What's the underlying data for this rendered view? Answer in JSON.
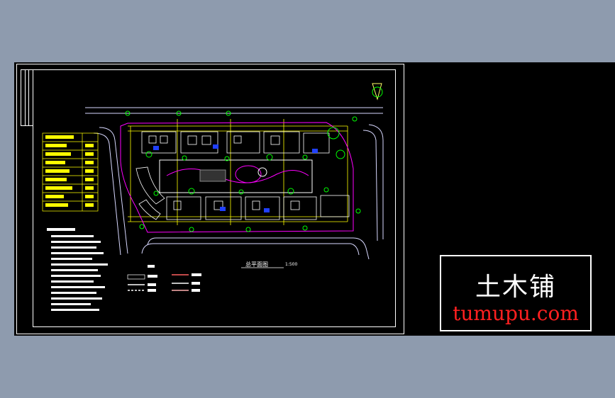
{
  "watermark": {
    "name_cn": "土木铺",
    "url": "tumupu.com"
  },
  "drawing": {
    "plan_title": "总平面图",
    "plan_scale": "1:500",
    "colors": {
      "background": "#000000",
      "frame": "#ffffff",
      "road": "#d8d8ff",
      "building": "#ffffff",
      "dimension": "#ffff00",
      "tree": "#00ff00",
      "path": "#ff00ff",
      "watermark_url": "#ff2020"
    }
  }
}
